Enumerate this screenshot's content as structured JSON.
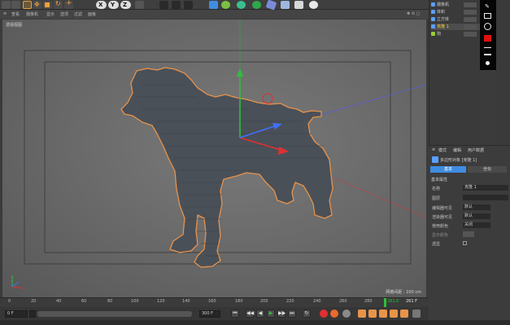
{
  "app": {
    "name": "Cinema 4D"
  },
  "toolbar": {
    "axis_buttons": [
      "X",
      "Y",
      "Z"
    ]
  },
  "menubar": {
    "items": [
      "查看",
      "摄像机",
      "显示",
      "选项",
      "过滤",
      "面板"
    ]
  },
  "viewport": {
    "label": "透视视图",
    "grid_spacing": "网格间距 : 100 cm"
  },
  "timeline": {
    "ticks": [
      "0",
      "20",
      "40",
      "60",
      "80",
      "100",
      "120",
      "140",
      "160",
      "180",
      "200",
      "220",
      "240",
      "260",
      "280"
    ],
    "current_frame": "261 F",
    "current_marker": "261.0"
  },
  "playback": {
    "start_field": "0 F",
    "end_field": "300 F",
    "min_field": "0 F",
    "max_field": "300 F",
    "buttons": [
      "⏮",
      "◀◀",
      "◀",
      "▶",
      "▶▶",
      "⏭"
    ]
  },
  "object_manager": {
    "objects": [
      {
        "name": "摄像机",
        "color": "#5aa0ff"
      },
      {
        "name": "体积",
        "color": "#5aa0ff"
      },
      {
        "name": "立方体",
        "color": "#5aa0ff"
      },
      {
        "name": "克隆 1",
        "color": "#ffd23a",
        "selected": true
      },
      {
        "name": "狗",
        "color": "#9acd32"
      }
    ]
  },
  "attributes": {
    "menu": [
      "模式",
      "编辑",
      "用户数据"
    ],
    "object_title": "多边形对象 [克隆 1]",
    "tabs": [
      "基本",
      "坐标"
    ],
    "section": "基本属性",
    "rows": [
      {
        "label": "名称",
        "value": "克隆 1"
      },
      {
        "label": "图层",
        "value": ""
      },
      {
        "label": "编辑器可见",
        "value": "默认"
      },
      {
        "label": "渲染器可见",
        "value": "默认"
      },
      {
        "label": "使用颜色",
        "value": "关闭"
      },
      {
        "label": "显示颜色",
        "value": ""
      },
      {
        "label": "透显",
        "value": ""
      }
    ]
  },
  "colors": {
    "accent_blue": "#3f8de0",
    "orange_outline": "#e8934a",
    "axis_x": "#e03030",
    "axis_y": "#2fbf3a",
    "axis_z": "#3f6fff",
    "red_swatch": "#e01010"
  }
}
